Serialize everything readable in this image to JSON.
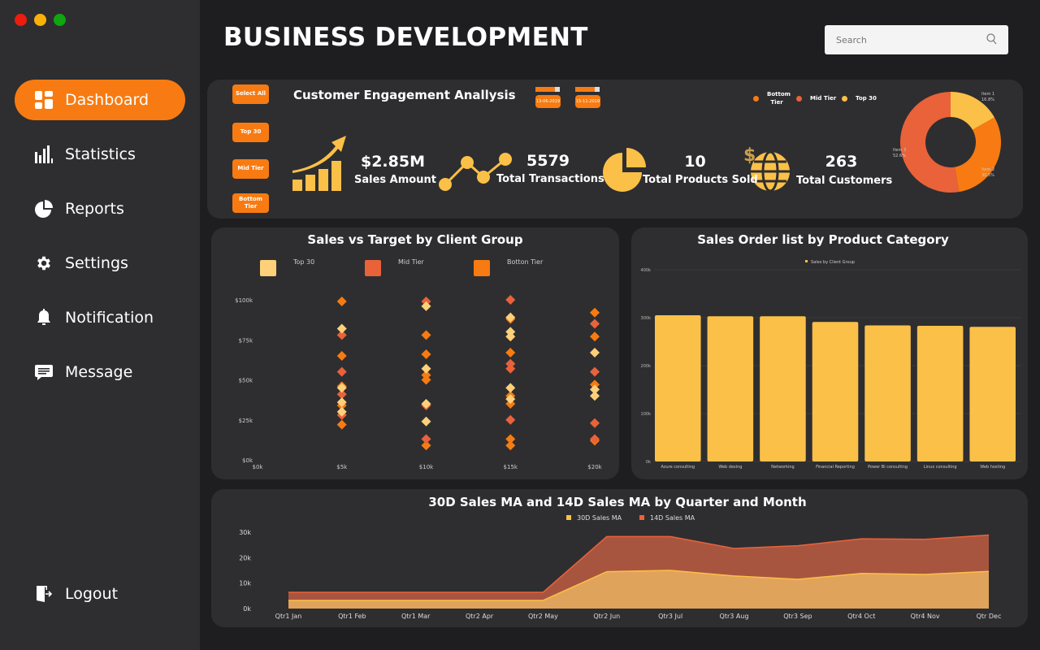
{
  "window": {
    "controls": [
      {
        "name": "close",
        "color": "#ee1c0e"
      },
      {
        "name": "minimize",
        "color": "#f9b10a"
      },
      {
        "name": "maximize",
        "color": "#0fa60f"
      }
    ]
  },
  "sidebar": {
    "items": [
      {
        "label": "Dashboard",
        "icon": "dashboard-icon",
        "active": true
      },
      {
        "label": "Statistics",
        "icon": "bar-chart-icon"
      },
      {
        "label": "Reports",
        "icon": "pie-chart-icon"
      },
      {
        "label": "Settings",
        "icon": "gear-icon"
      },
      {
        "label": "Notification",
        "icon": "bell-icon"
      },
      {
        "label": "Message",
        "icon": "message-icon"
      }
    ],
    "logout": {
      "label": "Logout",
      "icon": "logout-icon"
    }
  },
  "header": {
    "title": "BUSINESS DEVELOPMENT",
    "search_placeholder": "Search"
  },
  "engagement": {
    "title": "Customer Engagement Anallysis",
    "filters": [
      "Select All",
      "Top 30",
      "Mid Tier",
      "Bottom Tier"
    ],
    "date_start": "13-06-2019",
    "date_end": "15-11-2019",
    "legend": [
      {
        "label": "Bottom Tier",
        "color": "#f77b12"
      },
      {
        "label": "Mid Tier",
        "color": "#e9623a"
      },
      {
        "label": "Top 30",
        "color": "#fbc047"
      }
    ],
    "kpis": [
      {
        "value": "$2.85M",
        "label": "Sales Amount",
        "icon": "growth-chart-icon"
      },
      {
        "value": "5579",
        "label": "Total Transactions",
        "icon": "line-chart-icon"
      },
      {
        "value": "10",
        "label": "Total Products Sold",
        "icon": "pie-chart-icon"
      },
      {
        "value": "263",
        "label": "Total Customers",
        "icon": "globe-dollar-icon"
      }
    ]
  },
  "accent": "#f77b12",
  "chart_data": [
    {
      "type": "pie",
      "title": "",
      "donut": true,
      "slices": [
        {
          "label": "Item 1",
          "value": 16.8,
          "display": "16.8%",
          "color": "#fbc047"
        },
        {
          "label": "Item 2",
          "value": 30.5,
          "display": "30.5%",
          "color": "#f77b12"
        },
        {
          "label": "Item 3",
          "value": 52.6,
          "display": "52.6%",
          "color": "#e9623a"
        }
      ]
    },
    {
      "type": "scatter",
      "title": "Sales vs Target by Client Group",
      "legend": [
        {
          "label": "Top 30",
          "color": "#fed07a"
        },
        {
          "label": "Mid Tier",
          "color": "#e9623a"
        },
        {
          "label": "Botton Tier",
          "color": "#f77b12"
        }
      ],
      "xlim": [
        0,
        20
      ],
      "ylim": [
        0,
        100
      ],
      "x_ticks": [
        "$0k",
        "$5k",
        "$10k",
        "$15k",
        "$20k"
      ],
      "y_ticks": [
        "$0k",
        "$25k",
        "$50k",
        "$75k",
        "$100k"
      ],
      "series": [
        {
          "name": "Top 30",
          "points": [
            [
              5,
              82
            ],
            [
              5,
              45
            ],
            [
              5,
              36
            ],
            [
              5,
              30
            ],
            [
              10,
              96
            ],
            [
              10,
              57
            ],
            [
              10,
              35
            ],
            [
              10,
              24
            ],
            [
              15,
              89
            ],
            [
              15,
              80
            ],
            [
              15,
              77
            ],
            [
              15,
              45
            ],
            [
              15,
              38
            ],
            [
              20,
              67
            ],
            [
              20,
              44
            ],
            [
              20,
              40
            ]
          ]
        },
        {
          "name": "Mid Tier",
          "points": [
            [
              5,
              78
            ],
            [
              5,
              55
            ],
            [
              5,
              41
            ],
            [
              5,
              28
            ],
            [
              10,
              99
            ],
            [
              10,
              34
            ],
            [
              10,
              13
            ],
            [
              15,
              100
            ],
            [
              15,
              60
            ],
            [
              15,
              57
            ],
            [
              15,
              25
            ],
            [
              20,
              85
            ],
            [
              20,
              55
            ],
            [
              20,
              23
            ],
            [
              20,
              13
            ]
          ]
        },
        {
          "name": "Botton Tier",
          "points": [
            [
              5,
              99
            ],
            [
              5,
              65
            ],
            [
              5,
              46
            ],
            [
              5,
              34
            ],
            [
              5,
              22
            ],
            [
              10,
              78
            ],
            [
              10,
              66
            ],
            [
              10,
              53
            ],
            [
              10,
              50
            ],
            [
              10,
              9
            ],
            [
              15,
              88
            ],
            [
              15,
              67
            ],
            [
              15,
              40
            ],
            [
              15,
              35
            ],
            [
              15,
              13
            ],
            [
              15,
              9
            ],
            [
              20,
              92
            ],
            [
              20,
              77
            ],
            [
              20,
              47
            ],
            [
              20,
              12
            ]
          ]
        }
      ]
    },
    {
      "type": "bar",
      "title": "Sales Order list by Product Category",
      "legend": [
        {
          "label": "Sales by Client Group",
          "color": "#fbc047"
        }
      ],
      "categories": [
        "Azure consulting",
        "Web desing",
        "Networking",
        "Financial Reporting",
        "Power Bi consulting",
        "Linux consulting",
        "Web hosting"
      ],
      "values": [
        305000,
        303000,
        303000,
        291000,
        284000,
        283000,
        281000
      ],
      "ylim": [
        0,
        400000
      ],
      "y_ticks": [
        "0k",
        "100k",
        "200k",
        "300k",
        "400k"
      ],
      "color": "#fbc047"
    },
    {
      "type": "area",
      "title": "30D Sales MA and 14D Sales MA by Quarter and Month",
      "categories": [
        "Qtr1 Jan",
        "Qtr1 Feb",
        "Qtr1 Mar",
        "Qtr2 Apr",
        "Qtr2 May",
        "Qtr2 Jun",
        "Qtr3 Jul",
        "Qtr3 Aug",
        "Qtr3 Sep",
        "Qtr4 Oct",
        "Qtr4 Nov",
        "Qtr Dec"
      ],
      "ylim": [
        0,
        30000
      ],
      "y_ticks": [
        "0k",
        "10k",
        "20k",
        "30k"
      ],
      "stacked": true,
      "series": [
        {
          "name": "30D Sales MA",
          "color": "#e0a35c",
          "line": "#fbc047",
          "values": [
            3200,
            3200,
            3200,
            3200,
            3200,
            14500,
            15000,
            12800,
            11500,
            13800,
            13400,
            14600
          ]
        },
        {
          "name": "14D Sales MA",
          "color": "#a85540",
          "line": "#e9623a",
          "values": [
            3200,
            3200,
            3200,
            3200,
            3200,
            13800,
            13300,
            10800,
            13200,
            13600,
            13800,
            14300
          ]
        }
      ]
    }
  ]
}
